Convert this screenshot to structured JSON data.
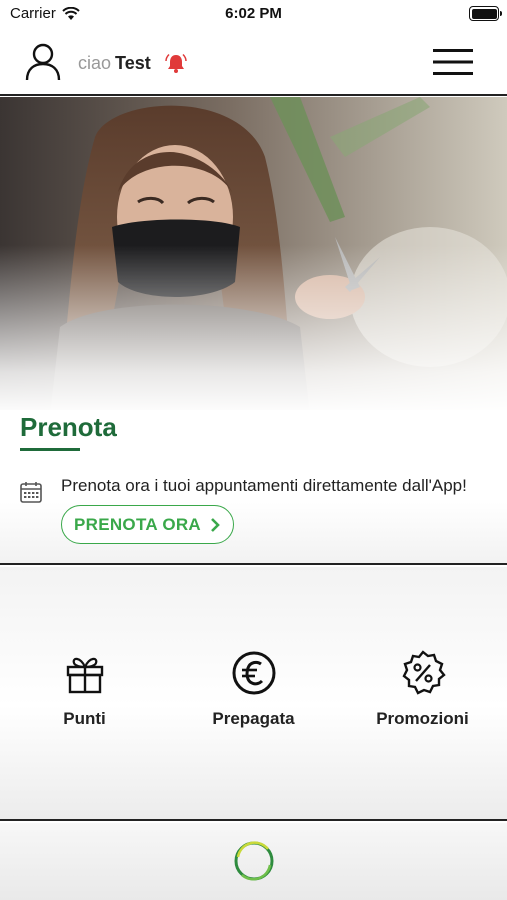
{
  "status_bar": {
    "carrier": "Carrier",
    "time": "6:02 PM"
  },
  "header": {
    "greeting": "ciao",
    "username": "Test"
  },
  "booking": {
    "title": "Prenota",
    "description": "Prenota ora i tuoi appuntamenti direttamente dall'App!",
    "button_label": "PRENOTA ORA"
  },
  "features": [
    {
      "label": "Punti",
      "icon": "gift-icon"
    },
    {
      "label": "Prepagata",
      "icon": "euro-icon"
    },
    {
      "label": "Promozioni",
      "icon": "discount-badge-icon"
    }
  ],
  "colors": {
    "brand_green": "#1f6b3a",
    "accent_green": "#3aa84a",
    "bell_red": "#e03a3a"
  }
}
